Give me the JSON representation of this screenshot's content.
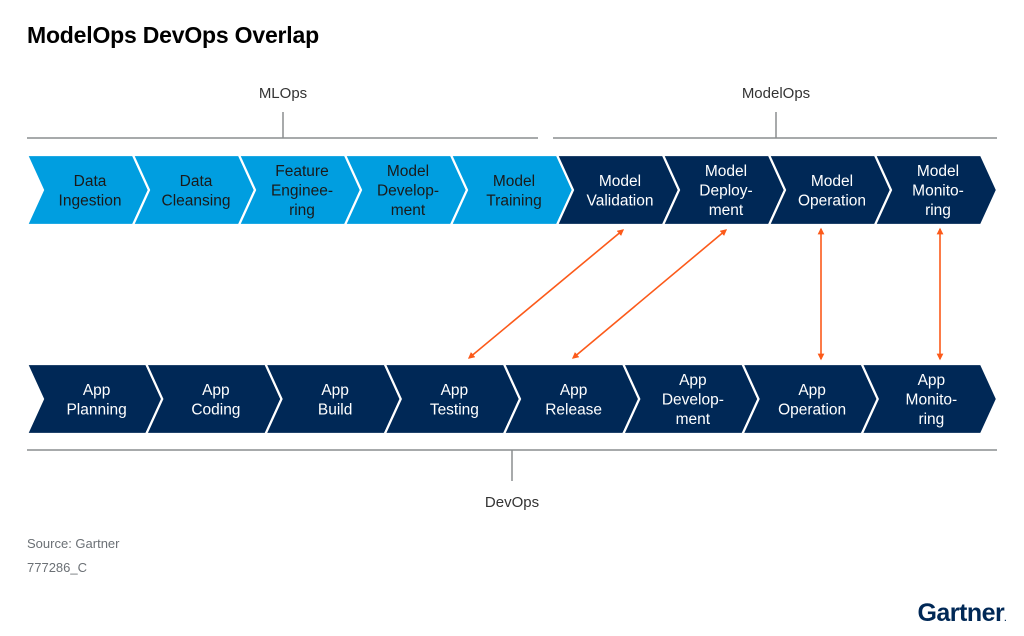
{
  "title": "ModelOps DevOps Overlap",
  "groups": {
    "mlops": "MLOps",
    "modelops": "ModelOps",
    "devops": "DevOps"
  },
  "colors": {
    "mlops_fill": "#009ee0",
    "modelops_fill": "#002856",
    "devops_fill": "#002856",
    "arrow": "#fc5a1a",
    "bracket": "#8a8d8f"
  },
  "top_row": [
    {
      "lines": [
        "Data",
        "Ingestion"
      ],
      "group": "mlops"
    },
    {
      "lines": [
        "Data",
        "Cleansing"
      ],
      "group": "mlops"
    },
    {
      "lines": [
        "Feature",
        "Enginee-",
        "ring"
      ],
      "group": "mlops"
    },
    {
      "lines": [
        "Model",
        "Develop-",
        "ment"
      ],
      "group": "mlops"
    },
    {
      "lines": [
        "Model",
        "Training"
      ],
      "group": "mlops"
    },
    {
      "lines": [
        "Model",
        "Validation"
      ],
      "group": "modelops"
    },
    {
      "lines": [
        "Model",
        "Deploy-",
        "ment"
      ],
      "group": "modelops"
    },
    {
      "lines": [
        "Model",
        "Operation"
      ],
      "group": "modelops"
    },
    {
      "lines": [
        "Model",
        "Monito-",
        "ring"
      ],
      "group": "modelops"
    }
  ],
  "bottom_row": [
    {
      "lines": [
        "App",
        "Planning"
      ]
    },
    {
      "lines": [
        "App",
        "Coding"
      ]
    },
    {
      "lines": [
        "App",
        "Build"
      ]
    },
    {
      "lines": [
        "App",
        "Testing"
      ]
    },
    {
      "lines": [
        "App",
        "Release"
      ]
    },
    {
      "lines": [
        "App",
        "Develop-",
        "ment"
      ]
    },
    {
      "lines": [
        "App",
        "Operation"
      ]
    },
    {
      "lines": [
        "App",
        "Monito-",
        "ring"
      ]
    }
  ],
  "links": [
    {
      "from": "Model Validation",
      "to": "App Testing"
    },
    {
      "from": "Model Deployment",
      "to": "App Release"
    },
    {
      "from": "Model Operation",
      "to": "App Operation"
    },
    {
      "from": "Model Monitoring",
      "to": "App Monitoring"
    }
  ],
  "footer": {
    "source": "Source: Gartner",
    "id": "777286_C"
  },
  "logo": {
    "text": "Gartner",
    "dot": "."
  }
}
